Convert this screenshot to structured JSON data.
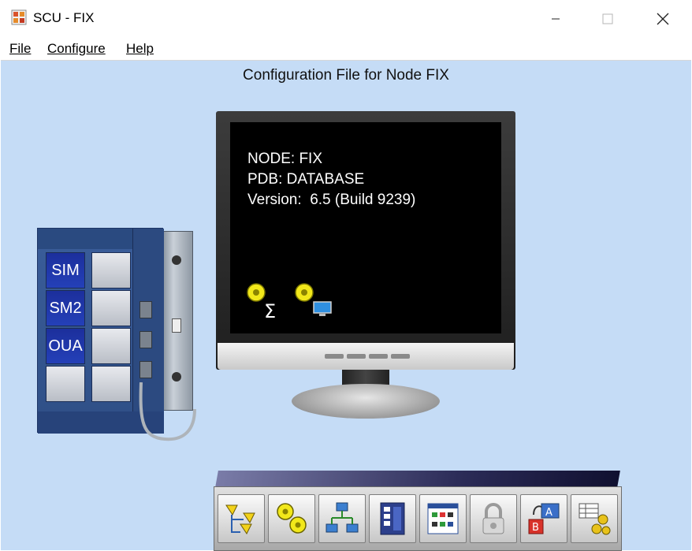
{
  "window": {
    "title": "SCU - FIX",
    "icon": "scu-app-icon",
    "controls": [
      "minimize-icon",
      "maximize-icon",
      "close-icon"
    ]
  },
  "menu": [
    {
      "label": "File",
      "accelerator_index": 0
    },
    {
      "label": "Configure",
      "accelerator_index": 0
    },
    {
      "label": "Help",
      "accelerator_index": 0
    }
  ],
  "main": {
    "caption": "Configuration File for Node FIX",
    "monitor": {
      "line1": "NODE: FIX",
      "line2": "PDB: DATABASE",
      "line3": "Version:  6.5 (Build 9239)",
      "icons": [
        "alarm-summary-icon",
        "alarm-display-icon"
      ]
    },
    "rack": {
      "slots": [
        {
          "label": "SIM"
        },
        {
          "label": "SM2"
        },
        {
          "label": "OUA"
        }
      ]
    },
    "toolbar": {
      "buttons": [
        "paths-configuration-icon",
        "alarm-configuration-icon",
        "network-configuration-icon",
        "scada-configuration-icon",
        "task-configuration-icon",
        "security-lock-icon",
        "local-startup-language-icon",
        "sql-configuration-icon"
      ]
    }
  },
  "colors": {
    "client_background": "#c5dcf6",
    "screen": "#000000",
    "rack_blue": "#2440b8"
  }
}
